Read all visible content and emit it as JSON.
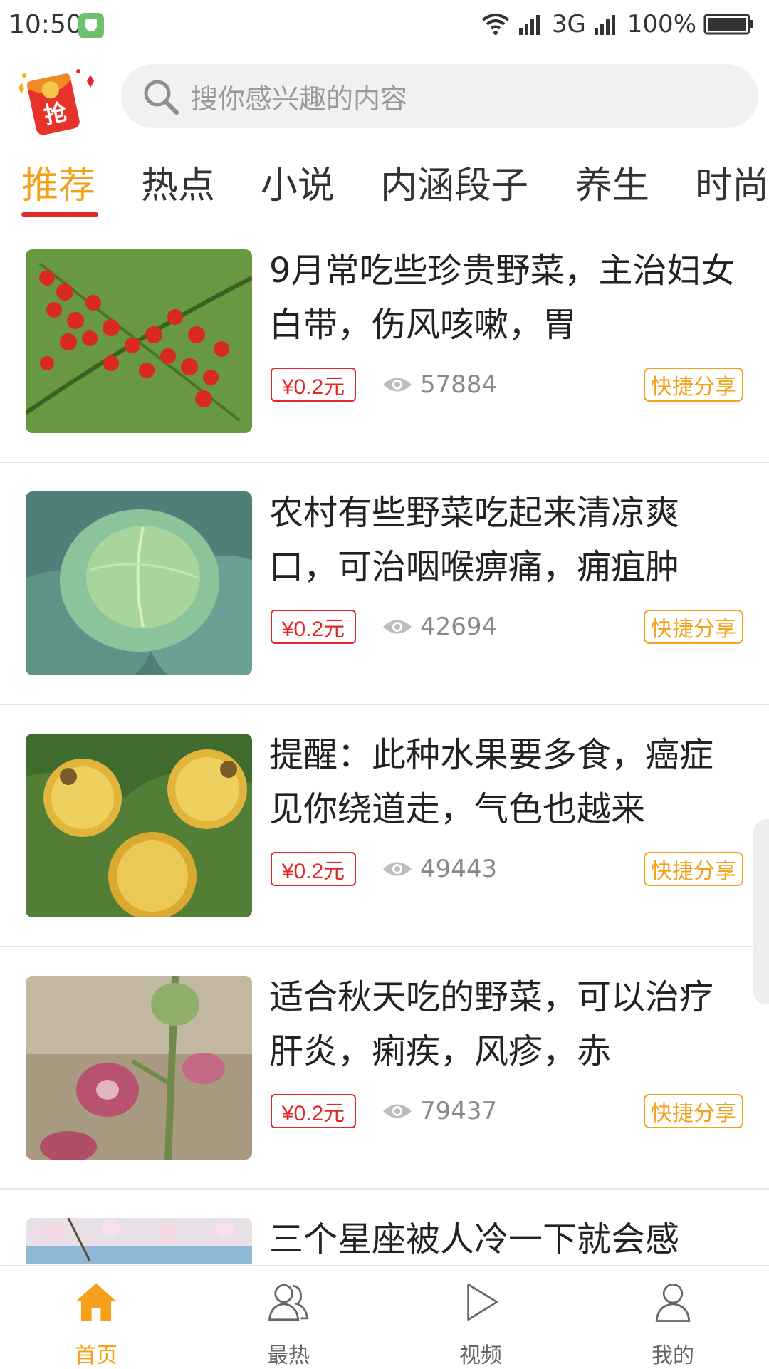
{
  "status_bar": {
    "time": "10:50",
    "network": "3G",
    "battery": "100%"
  },
  "search": {
    "placeholder": "搜你感兴趣的内容"
  },
  "logo": {
    "text": "抢"
  },
  "tabs": [
    "推荐",
    "热点",
    "小说",
    "内涵段子",
    "养生",
    "时尚"
  ],
  "active_tab": 0,
  "articles": [
    {
      "title": "9月常吃些珍贵野菜，主治妇女白带，伤风咳嗽，胃",
      "reward": "¥0.2元",
      "views": "57884",
      "share": "快捷分享",
      "image": "red-berries"
    },
    {
      "title": "农村有些野菜吃起来清凉爽口，可治咽喉痹痛，痈疽肿",
      "reward": "¥0.2元",
      "views": "42694",
      "share": "快捷分享",
      "image": "cabbage"
    },
    {
      "title": "提醒：此种水果要多食，癌症见你绕道走，气色也越来",
      "reward": "¥0.2元",
      "views": "49443",
      "share": "快捷分享",
      "image": "yellow-spiky-fruit"
    },
    {
      "title": "适合秋天吃的野菜，可以治疗肝炎，痢疾，风疹，赤",
      "reward": "¥0.2元",
      "views": "79437",
      "share": "快捷分享",
      "image": "pink-flower"
    },
    {
      "title": "三个星座被人冷一下就会感",
      "image": "blossom-sky"
    }
  ],
  "bottom_nav": [
    {
      "label": "首页",
      "icon": "home-icon",
      "active": true
    },
    {
      "label": "最热",
      "icon": "users-icon",
      "active": false
    },
    {
      "label": "视频",
      "icon": "play-icon",
      "active": false
    },
    {
      "label": "我的",
      "icon": "user-icon",
      "active": false
    }
  ],
  "colors": {
    "accent": "#f5a01a",
    "reward": "#e0282a",
    "underline": "#e02b2b"
  }
}
